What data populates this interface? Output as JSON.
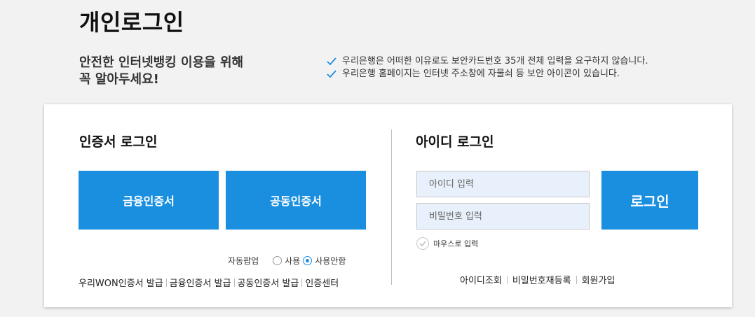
{
  "page": {
    "title": "개인로그인"
  },
  "notice": {
    "headline_line1": "안전한 인터넷뱅킹 이용을 위해",
    "headline_line2": "꼭 알아두세요!",
    "items": [
      "우리은행은 어떠한 이유로도 보안카드번호 35개 전체 입력을 요구하지 않습니다.",
      "우리은행 홈페이지는 인터넷 주소창에 자물쇠 등 보안 아이콘이 있습니다."
    ]
  },
  "cert_login": {
    "title": "인증서 로그인",
    "financial_cert_label": "금융인증서",
    "public_cert_label": "공동인증서",
    "auto_popup_label": "자동팝업",
    "options": [
      "사용",
      "사용안함"
    ],
    "selected_option": "사용안함",
    "links": [
      "우리WON인증서 발급",
      "금융인증서 발급",
      "공동인증서 발급",
      "인증센터"
    ]
  },
  "id_login": {
    "title": "아이디 로그인",
    "id_placeholder": "아이디 입력",
    "password_placeholder": "비밀번호 입력",
    "login_label": "로그인",
    "mouse_input_label": "마우스로 입력",
    "links": [
      "아이디조회",
      "비밀번호재등록",
      "회원가입"
    ]
  },
  "colors": {
    "accent": "#1a8fe0",
    "check": "#1a8fe0",
    "background": "#f2f2f2",
    "input_bg": "#e8f0fb"
  }
}
